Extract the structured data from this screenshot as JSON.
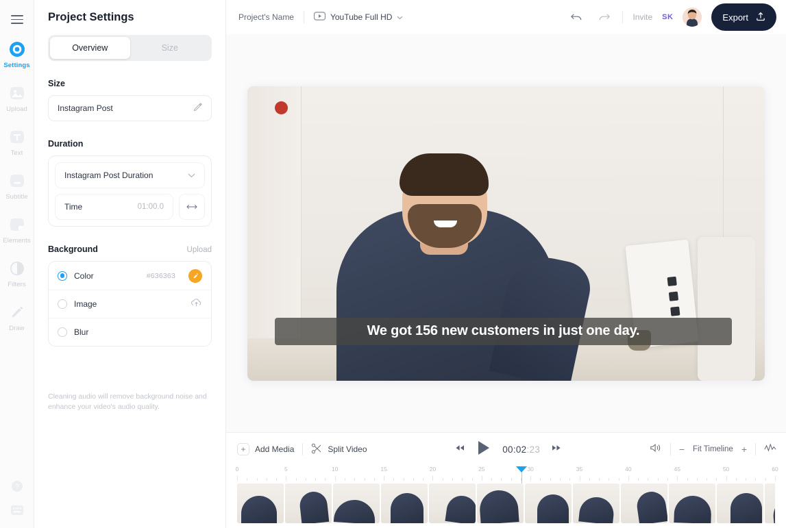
{
  "rail": {
    "menu_icon": "hamburger-icon",
    "items": [
      {
        "label": "Settings",
        "icon": "settings-target-icon",
        "active": true
      },
      {
        "label": "Upload",
        "icon": "image-upload-icon",
        "active": false
      },
      {
        "label": "Text",
        "icon": "text-t-icon",
        "active": false
      },
      {
        "label": "Subtitle",
        "icon": "subtitle-icon",
        "active": false
      },
      {
        "label": "Elements",
        "icon": "elements-shape-icon",
        "active": false
      },
      {
        "label": "Filters",
        "icon": "filters-contrast-icon",
        "active": false
      },
      {
        "label": "Draw",
        "icon": "draw-pencil-icon",
        "active": false
      }
    ],
    "bottom": [
      {
        "icon": "help-question-icon"
      },
      {
        "icon": "keyboard-shortcuts-icon"
      }
    ]
  },
  "panel": {
    "title": "Project Settings",
    "tabs": [
      {
        "label": "Overview",
        "active": true
      },
      {
        "label": "Size",
        "active": false
      }
    ],
    "size": {
      "label": "Size",
      "value": "Instagram Post",
      "edit_icon": "pencil-icon"
    },
    "duration": {
      "label": "Duration",
      "preset": "Instagram Post Duration",
      "chevron_icon": "chevron-down-icon",
      "time_label": "Time",
      "time_value": "01:00.0",
      "fit_icon": "arrows-horizontal-icon"
    },
    "background": {
      "label": "Background",
      "upload_link": "Upload",
      "options": [
        {
          "label": "Color",
          "selected": true,
          "value": "#636363",
          "icon": "color-picker-icon",
          "icon_bg": "#f5a623"
        },
        {
          "label": "Image",
          "selected": false,
          "value": "",
          "icon": "cloud-upload-icon",
          "icon_bg": ""
        },
        {
          "label": "Blur",
          "selected": false,
          "value": "",
          "icon": "",
          "icon_bg": ""
        }
      ]
    },
    "note": "Cleaning audio will remove background noise and enhance your video's audio quality."
  },
  "topbar": {
    "project_name": "Project's Name",
    "preset_icon": "youtube-play-icon",
    "preset_label": "YouTube Full HD",
    "preset_chevron": "chevron-down-icon",
    "undo_icon": "undo-arrow-icon",
    "redo_icon": "redo-arrow-icon",
    "invite_label": "Invite",
    "collaborator_initials": "SK",
    "avatar": "user-avatar",
    "export_label": "Export",
    "export_icon": "export-upload-icon",
    "export_bg": "#17213a"
  },
  "preview": {
    "caption": "We got 156 new customers in just one day."
  },
  "timeline": {
    "add_media_label": "Add Media",
    "add_media_icon": "plus-icon",
    "split_video_label": "Split Video",
    "split_video_icon": "scissors-icon",
    "skip_back_icon": "skip-back-icon",
    "play_icon": "play-icon",
    "skip_forward_icon": "skip-forward-icon",
    "current_time_main": "00:02",
    "current_time_frames": ":23",
    "volume_icon": "speaker-volume-icon",
    "zoom_out_icon": "minus-icon",
    "fit_label": "Fit Timeline",
    "zoom_in_icon": "plus-icon",
    "waveform_icon": "audio-waveform-icon",
    "ruler_labels": [
      "0",
      "5",
      "10",
      "15",
      "20",
      "25",
      "30",
      "35",
      "40",
      "45",
      "50",
      "60"
    ],
    "playhead_label": "30",
    "add_clip_icon": "plus-icon",
    "accent_color": "#1da1f2"
  }
}
